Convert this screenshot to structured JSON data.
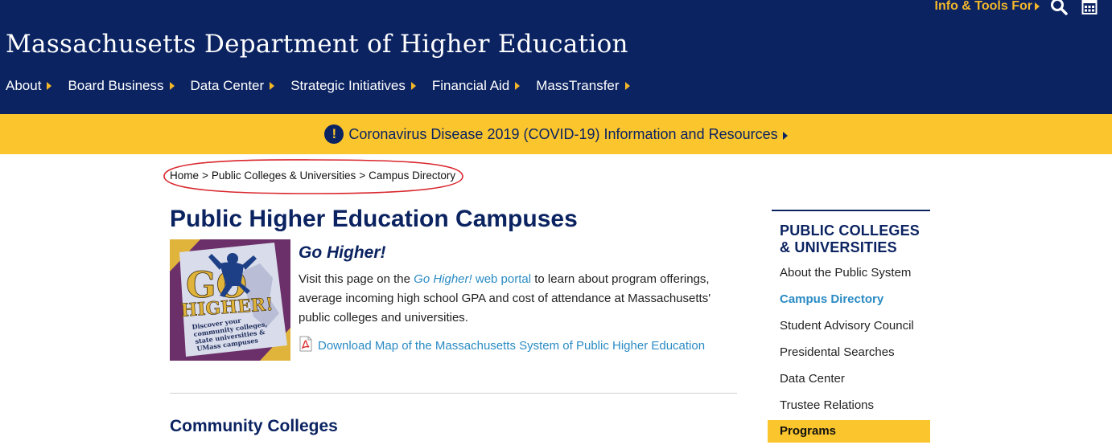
{
  "header": {
    "utility_link": "Info & Tools For",
    "utility_icons": [
      "search-icon",
      "calendar-icon"
    ],
    "site_title": "Massachusetts Department of Higher Education",
    "nav": [
      "About",
      "Board Business",
      "Data Center",
      "Strategic Initiatives",
      "Financial Aid",
      "MassTransfer"
    ]
  },
  "alert": {
    "icon": "!",
    "text": "Coronavirus Disease 2019 (COVID-19) Information and Resources"
  },
  "breadcrumb": [
    "Home",
    ">",
    "Public Colleges & Universities",
    ">",
    "Campus Directory"
  ],
  "main": {
    "title": "Public Higher Education Campuses",
    "promo": {
      "image_text": {
        "go": "GO",
        "higher": "HIGHER!",
        "line1": "Discover your",
        "line2": "community colleges,",
        "line3": "state universities &",
        "line4": "UMass campuses"
      },
      "heading": "Go Higher!",
      "body_pre": "Visit this page on the ",
      "link_italic": "Go Higher!",
      "link_rest": " web portal",
      "body_post": " to learn about program offerings, average incoming high school GPA and cost of attendance at Massachusetts' public colleges and universities.",
      "pdf_link": "Download Map of the Massachusetts System of Public Higher Education"
    },
    "section_title": "Community Colleges"
  },
  "sidebar": {
    "heading": "PUBLIC COLLEGES & UNIVERSITIES",
    "items": [
      "About the Public System",
      "Campus Directory",
      "Student Advisory Council",
      "Presidental Searches",
      "Data Center",
      "Trustee Relations"
    ],
    "active_item": "Campus Directory",
    "programs": "Programs"
  },
  "colors": {
    "navy": "#0b2361",
    "gold": "#fbc52d",
    "link": "#2a8bc4",
    "annotation": "#d9262c"
  }
}
